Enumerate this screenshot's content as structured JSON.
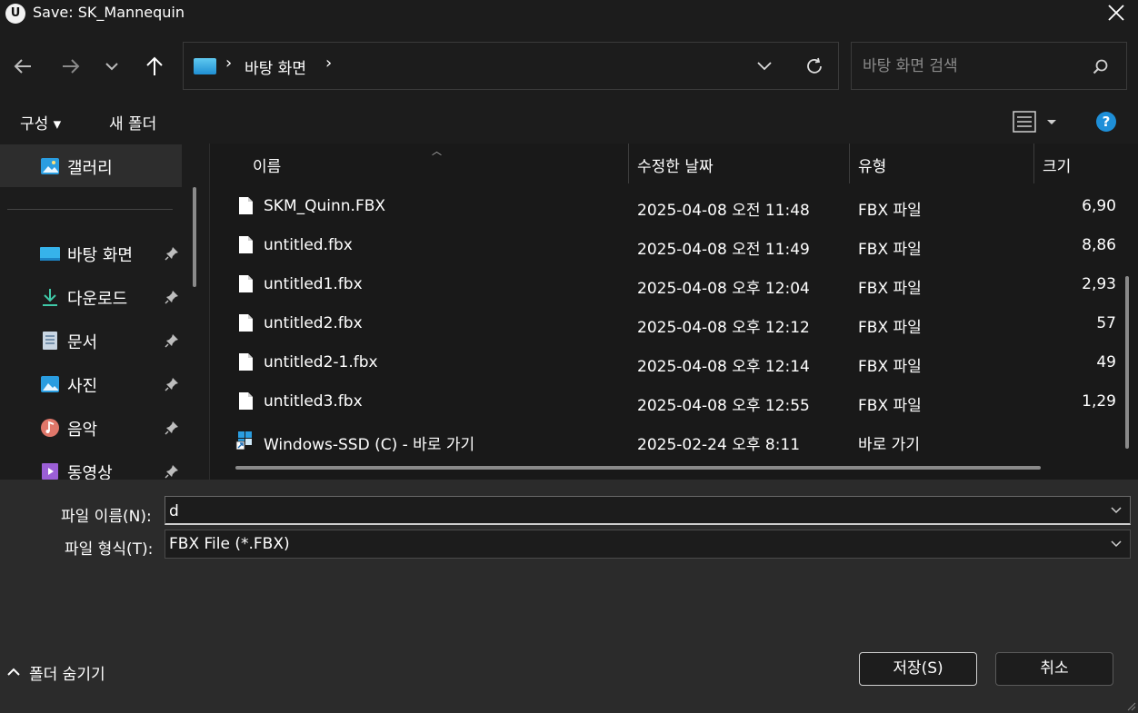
{
  "window": {
    "title": "Save: SK_Mannequin",
    "app_logo_text": "U"
  },
  "nav": {
    "address_path": "바탕 화면",
    "search_placeholder": "바탕 화면 검색"
  },
  "commands": {
    "organize_label": "구성 ▾",
    "new_folder_label": "새 폴더"
  },
  "sidebar": {
    "items": [
      {
        "label": "갤러리",
        "icon": "gallery-icon"
      },
      {
        "label": "바탕 화면",
        "icon": "desktop-icon",
        "pinned": true
      },
      {
        "label": "다운로드",
        "icon": "download-icon",
        "pinned": true
      },
      {
        "label": "문서",
        "icon": "document-icon",
        "pinned": true
      },
      {
        "label": "사진",
        "icon": "pictures-icon",
        "pinned": true
      },
      {
        "label": "음악",
        "icon": "music-icon",
        "pinned": true
      },
      {
        "label": "동영상",
        "icon": "video-icon",
        "pinned": true
      }
    ]
  },
  "columns": {
    "name": "이름",
    "date": "수정한 날짜",
    "type": "유형",
    "size": "크기"
  },
  "files": [
    {
      "name": "SKM_Quinn.FBX",
      "date": "2025-04-08 오전 11:48",
      "type": "FBX 파일",
      "size": "6,90"
    },
    {
      "name": "untitled.fbx",
      "date": "2025-04-08 오전 11:49",
      "type": "FBX 파일",
      "size": "8,86"
    },
    {
      "name": "untitled1.fbx",
      "date": "2025-04-08 오후 12:04",
      "type": "FBX 파일",
      "size": "2,93"
    },
    {
      "name": "untitled2.fbx",
      "date": "2025-04-08 오후 12:12",
      "type": "FBX 파일",
      "size": "57"
    },
    {
      "name": "untitled2-1.fbx",
      "date": "2025-04-08 오후 12:14",
      "type": "FBX 파일",
      "size": "49"
    },
    {
      "name": "untitled3.fbx",
      "date": "2025-04-08 오후 12:55",
      "type": "FBX 파일",
      "size": "1,29"
    },
    {
      "name": "Windows-SSD (C) - 바로 가기",
      "date": "2025-02-24 오후 8:11",
      "type": "바로 가기",
      "size": ""
    }
  ],
  "form": {
    "file_name_label": "파일 이름(N):",
    "file_name_value": "d",
    "file_type_label": "파일 형식(T):",
    "file_type_value": "FBX File (*.FBX)"
  },
  "footer": {
    "hide_folders_label": "폴더 숨기기",
    "save_label": "저장(S)",
    "cancel_label": "취소"
  },
  "colors": {
    "background": "#1c1c1c",
    "list_background": "#191919",
    "bottom_panel": "#2b2b2b",
    "accent_blue": "#1e8fd8"
  }
}
